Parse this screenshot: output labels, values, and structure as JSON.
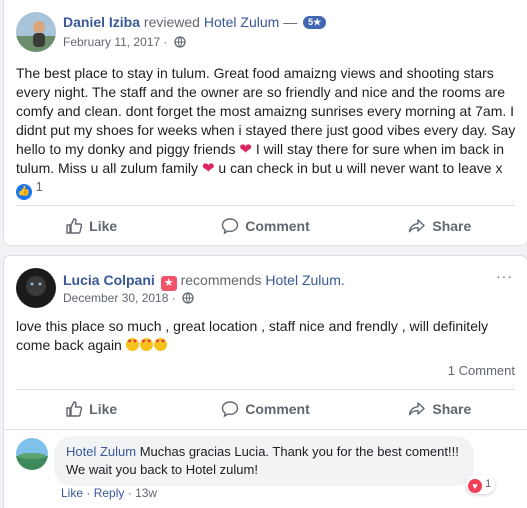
{
  "post1": {
    "author": "Daniel Iziba",
    "verb": "reviewed",
    "target": "Hotel Zulum",
    "dash": "—",
    "rating_badge": "5★",
    "date": "February 11, 2017",
    "dot": "·",
    "text_a": "The best place to stay in tulum. Great food amaizng views and shooting stars every night. The staff and the owner are so friendly and nice and the rooms are comfy and clean. dont forget the most amaizng sunrises every morning at 7am. I didnt put my shoes for weeks when i stayed there just good vibes every day. Say hello to my donky and piggy friends ",
    "text_b": " I will stay there for sure when im back in tulum. Miss u all zulum family ",
    "text_c": " u can check in but u will never want to leave x",
    "like_count": "1",
    "actions": {
      "like": "Like",
      "comment": "Comment",
      "share": "Share"
    }
  },
  "post2": {
    "author": "Lucia Colpani",
    "verb": "recommends",
    "target": "Hotel Zulum.",
    "date": "December 30, 2018",
    "dot": "·",
    "text": "love this place so much , great location , staff nice and frendly , will definitely come back again ",
    "comment_count": "1 Comment",
    "actions": {
      "like": "Like",
      "comment": "Comment",
      "share": "Share"
    },
    "reply": {
      "author": "Hotel Zulum",
      "text": " Muchas gracias Lucia. Thank you for the best coment!!! We wait you back to Hotel zulum!",
      "reaction_count": "1",
      "like": "Like",
      "sep": "·",
      "reply_label": "Reply",
      "time": "13w"
    }
  },
  "colors": {
    "link": "#385898",
    "secondary": "#606770",
    "like_blue": "#1877f2",
    "heart_red": "#e0245e",
    "background": "#f0f2f5"
  }
}
